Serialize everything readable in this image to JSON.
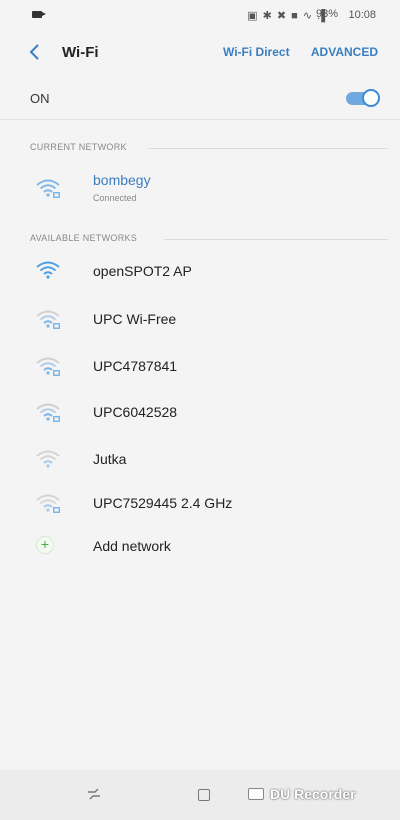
{
  "status": {
    "icons": "▣ ✱ ✖ ■ ∿ .▌",
    "battery": "93%",
    "time": "10:08"
  },
  "appbar": {
    "title": "Wi-Fi",
    "wifi_direct": "Wi-Fi Direct",
    "advanced": "ADVANCED"
  },
  "master_switch": {
    "label": "ON",
    "state": "on",
    "accent": "#3a8bd8"
  },
  "current": {
    "header": "CURRENT NETWORK",
    "network": {
      "name": "bombegy",
      "status": "Connected",
      "secured": true
    }
  },
  "available": {
    "header": "AVAILABLE NETWORKS",
    "networks": [
      {
        "name": "openSPOT2 AP",
        "secured": false
      },
      {
        "name": "UPC Wi-Free",
        "secured": true
      },
      {
        "name": "UPC4787841",
        "secured": true
      },
      {
        "name": "UPC6042528",
        "secured": true
      },
      {
        "name": "Jutka",
        "secured": false
      },
      {
        "name": "UPC7529445 2.4 GHz",
        "secured": true
      }
    ],
    "add_label": "Add network"
  },
  "navbar": {
    "watermark": "DU Recorder"
  }
}
